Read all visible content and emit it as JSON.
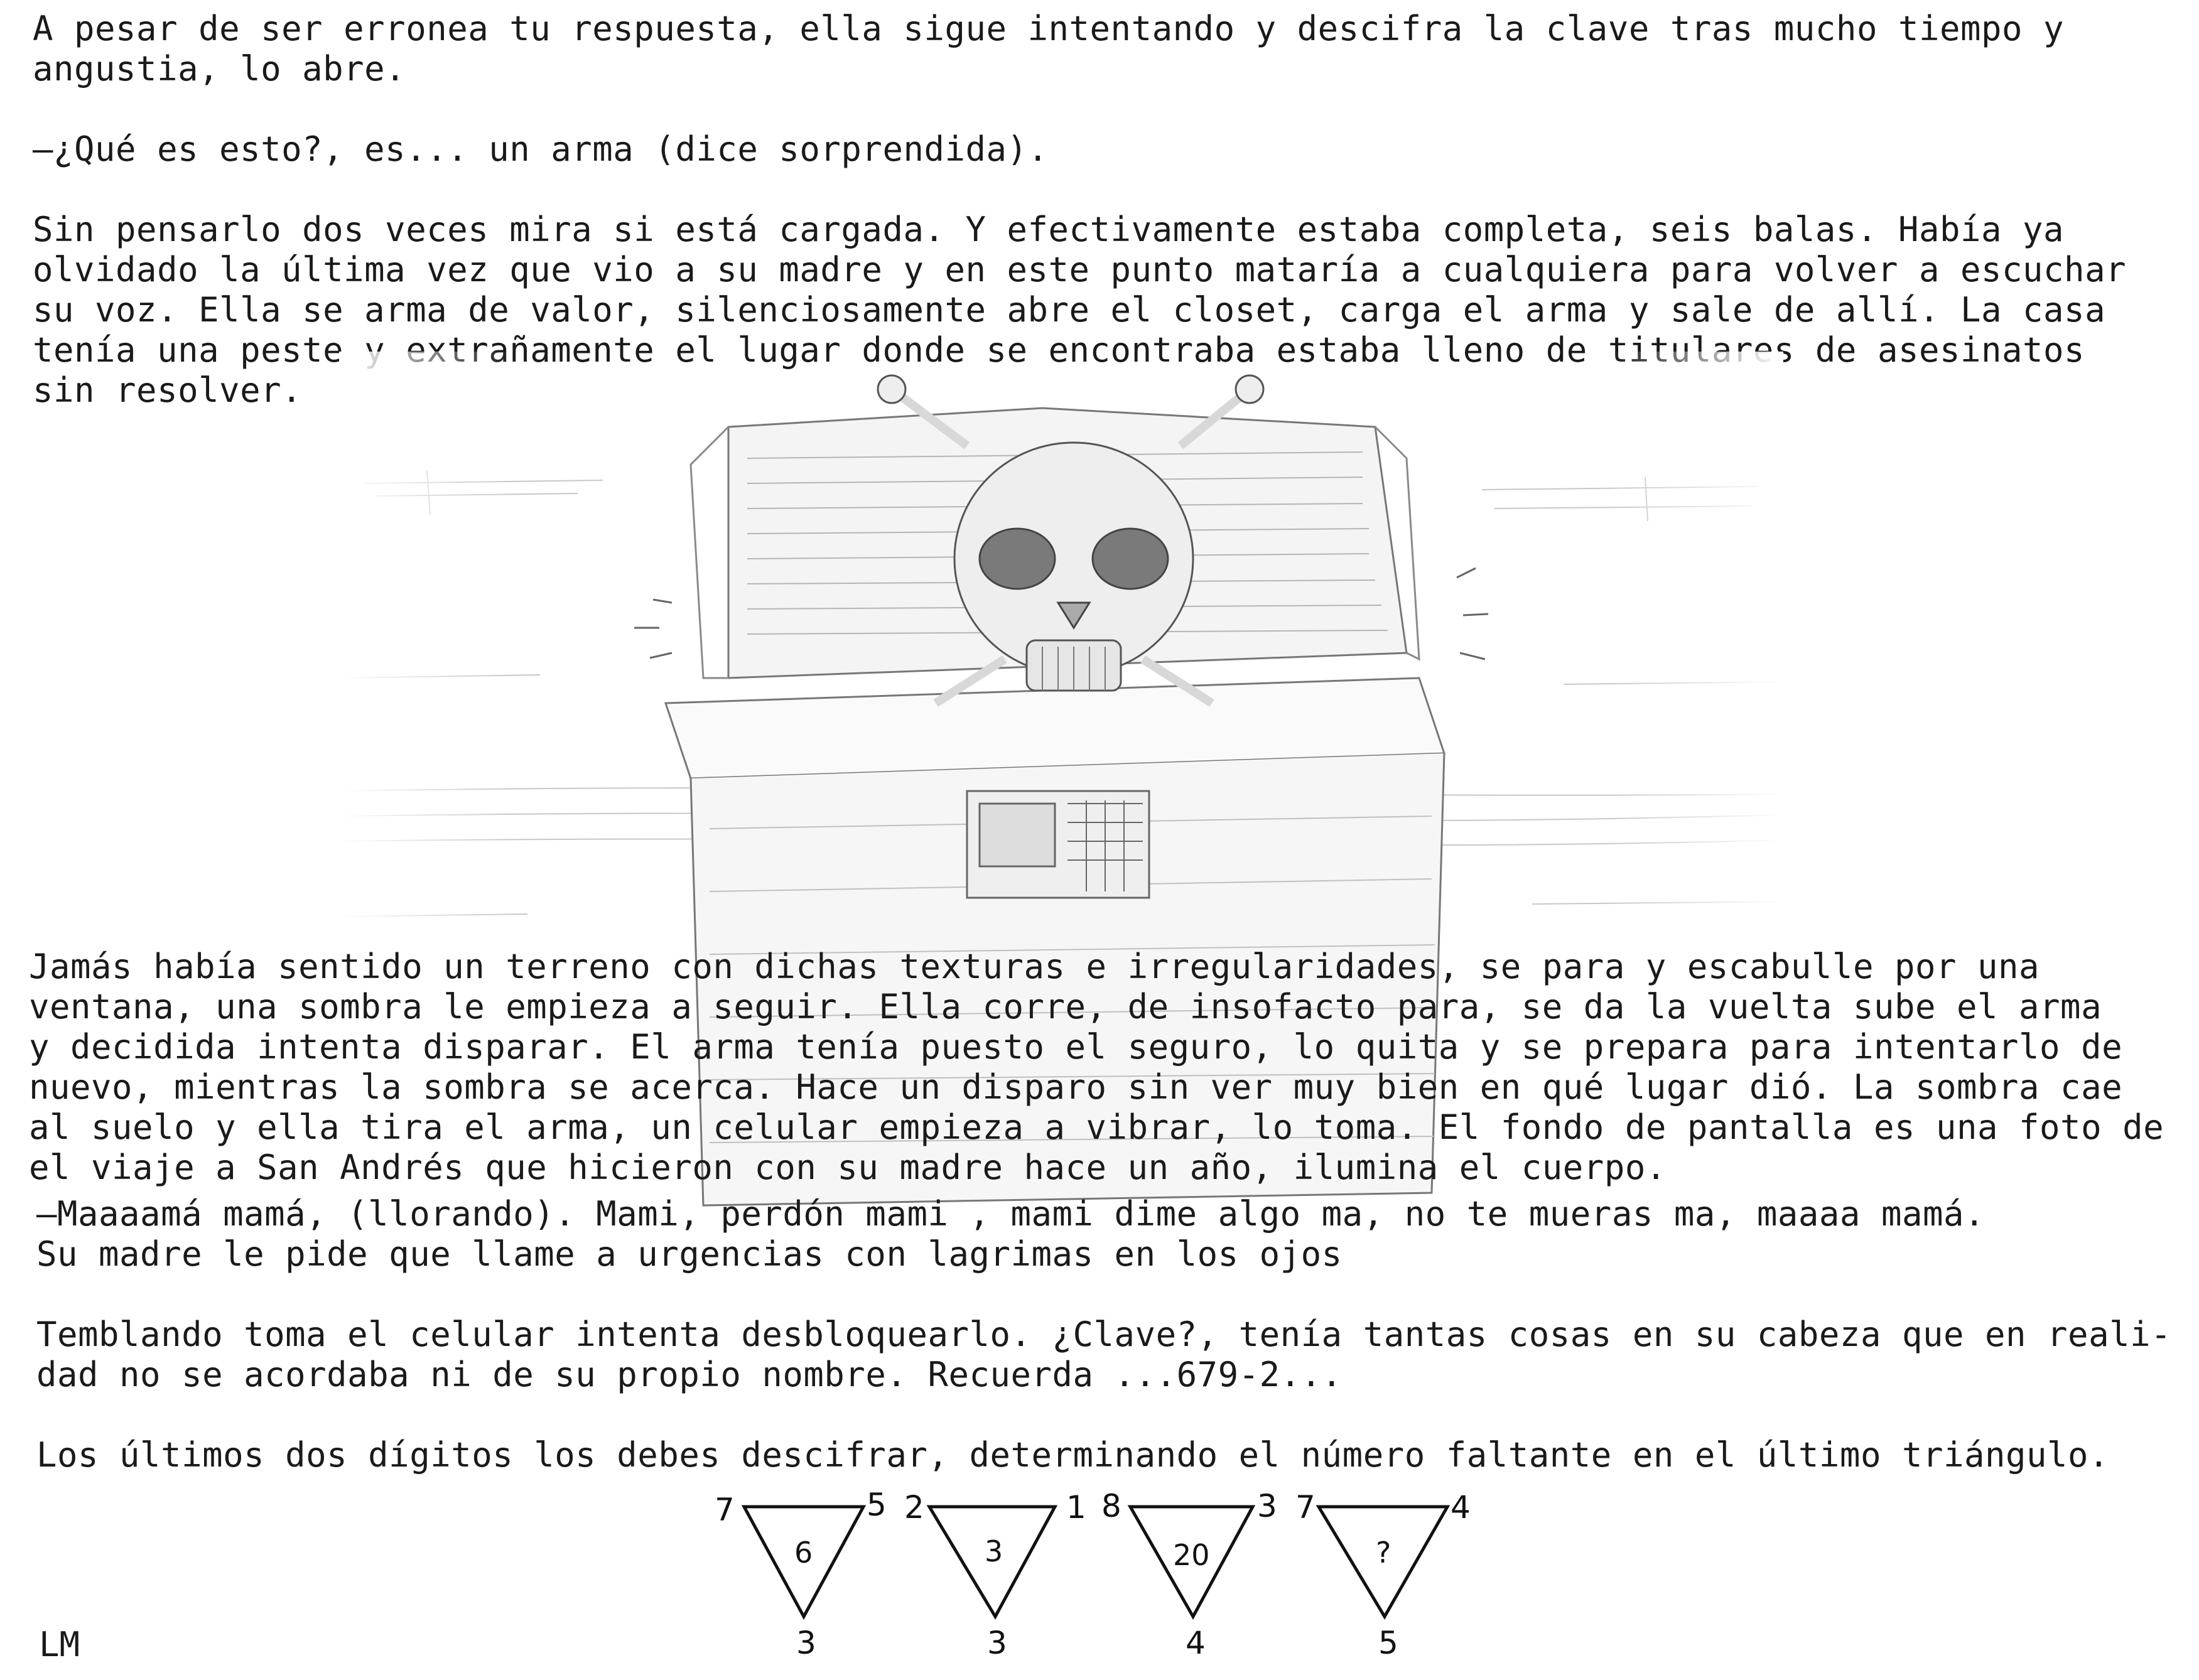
{
  "paragraphs": {
    "p1": "A pesar de ser erronea tu respuesta, ella sigue intentando y descifra la clave tras mucho tiempo y\nangustia, lo abre.",
    "p2": "—¿Qué es esto?, es... un arma (dice sorprendida).",
    "p3": "Sin pensarlo dos veces mira si está cargada. Y efectivamente estaba completa, seis balas. Había ya\nolvidado la última vez que vio a su madre y en este punto mataría a cualquiera para volver a escuchar\nsu voz. Ella se arma de valor, silenciosamente abre el closet, carga el arma y sale de allí. La casa\ntenía una peste y extrañamente el lugar donde se encontraba estaba lleno de titulares de asesinatos\nsin resolver.",
    "p4": "Jamás había sentido un terreno con dichas texturas e irregularidades, se para y escabulle por una\nventana, una sombra le empieza a seguir. Ella corre, de insofacto para, se da la vuelta sube el arma\ny decidida intenta disparar. El arma tenía puesto el seguro, lo quita y se prepara para intentarlo de\nnuevo, mientras la sombra se acerca. Hace un disparo sin ver muy bien en qué lugar dió. La sombra cae\nal suelo y ella tira el arma, un celular empieza a vibrar, lo toma. El fondo de pantalla es una foto de\nel viaje a San Andrés que hicieron con su madre hace un año, ilumina el cuerpo.",
    "p5": "—Maaaamá mamá, (llorando). Mami, perdón mami , mami dime algo ma, no te mueras ma, maaaa mamá.\nSu madre le pide que llame a urgencias con lagrimas en los ojos",
    "p6": "Temblando toma el celular intenta desbloquearlo. ¿Clave?, tenía tantas cosas en su cabeza que en reali-\ndad no se acordaba ni de su propio nombre. Recuerda ...679-2...",
    "p7": "Los últimos dos dígitos los debes descifrar, determinando el número faltante en el último triángulo."
  },
  "puzzle": [
    {
      "top_left": "7",
      "top_right": "5",
      "bottom": "3",
      "center": "6"
    },
    {
      "top_left": "2",
      "top_right": "1",
      "bottom": "3",
      "center": "3"
    },
    {
      "top_left": "8",
      "top_right": "3",
      "bottom": "4",
      "center": "20"
    },
    {
      "top_left": "7",
      "top_right": "4",
      "bottom": "5",
      "center": "?"
    }
  ],
  "signature": "LM",
  "illustration": {
    "icon": "skull-and-crossbones-treasure-chest-sketch"
  }
}
